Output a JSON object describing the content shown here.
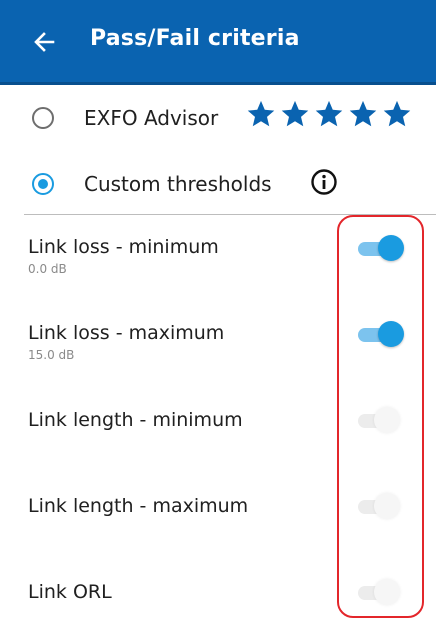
{
  "header": {
    "title": "Pass/Fail criteria",
    "back_icon": "arrow-left-icon",
    "background_color": "#0a63b0"
  },
  "criteria_options": [
    {
      "label": "EXFO Advisor",
      "selected": false,
      "rating_stars": 5
    },
    {
      "label": "Custom thresholds",
      "selected": true,
      "info_icon": "info-circle-icon"
    }
  ],
  "thresholds": [
    {
      "label": "Link loss - minimum",
      "value": "0.0 dB",
      "enabled": true
    },
    {
      "label": "Link loss - maximum",
      "value": "15.0 dB",
      "enabled": true
    },
    {
      "label": "Link length - minimum",
      "value": "",
      "enabled": false
    },
    {
      "label": "Link length - maximum",
      "value": "",
      "enabled": false
    },
    {
      "label": "Link ORL",
      "value": "",
      "enabled": false
    }
  ],
  "colors": {
    "accent": "#1a9be0",
    "star": "#0a63b0",
    "highlight": "#e3262b"
  }
}
